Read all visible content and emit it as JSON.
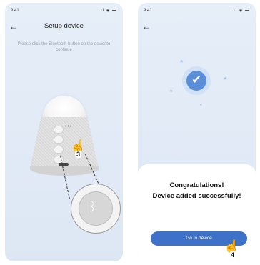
{
  "left_screen": {
    "status": {
      "time": "9:41",
      "icons": ".ıl ◈ ▬"
    },
    "nav": {
      "back_icon": "arrow-left-icon",
      "title": "Setup device"
    },
    "instruction": "Please click the Bluetooth button on the deviceto continue",
    "step_badge": "3",
    "icons": {
      "hand": "pointing-hand-icon",
      "bluetooth": "bluetooth-icon"
    }
  },
  "right_screen": {
    "status": {
      "time": "9:41",
      "icons": ".ıl ◈ ▬"
    },
    "nav": {
      "back_icon": "arrow-left-icon"
    },
    "success_icon": "check-icon",
    "dialog": {
      "heading": "Congratulations!",
      "message": "Device added successfully!",
      "button_label": "Go to device"
    },
    "step_badge": "4",
    "colors": {
      "accent": "#3d72c8",
      "check": "#5b8ed8"
    }
  }
}
